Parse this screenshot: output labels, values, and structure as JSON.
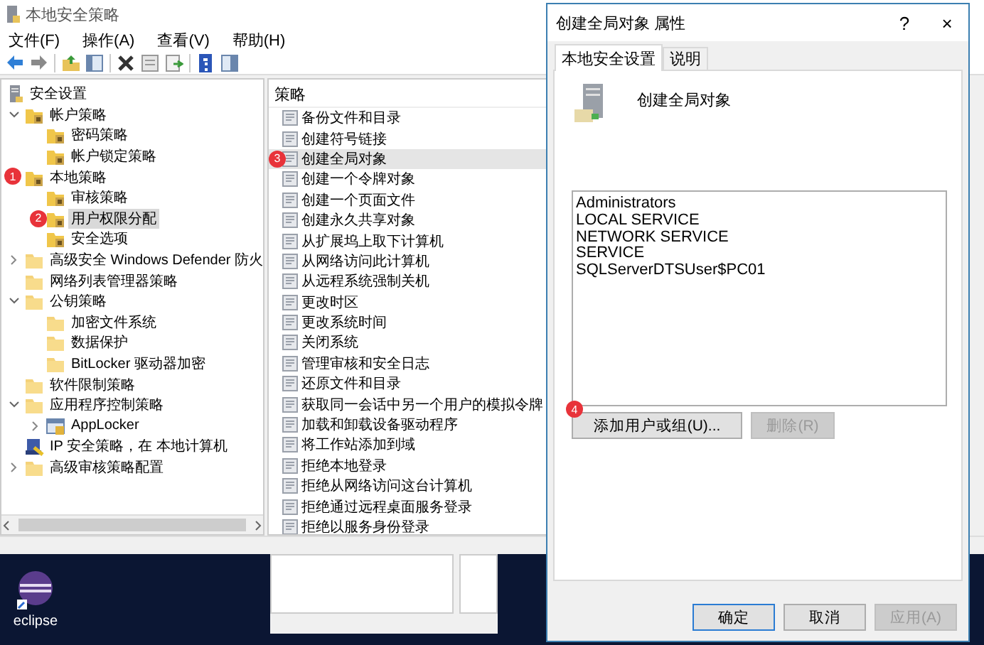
{
  "main_window": {
    "title": "本地安全策略",
    "menu": [
      "文件(F)",
      "操作(A)",
      "查看(V)",
      "帮助(H)"
    ],
    "tree": [
      {
        "label": "安全设置",
        "kind": "root",
        "selected": false,
        "children": [
          {
            "label": "帐户策略",
            "kind": "policy",
            "expanded": true,
            "selected": false,
            "children": [
              {
                "label": "密码策略",
                "kind": "policy",
                "selected": false
              },
              {
                "label": "帐户锁定策略",
                "kind": "policy",
                "selected": false
              }
            ]
          },
          {
            "label": "本地策略",
            "kind": "policy",
            "badge": "1",
            "selected": false,
            "children": [
              {
                "label": "审核策略",
                "kind": "policy",
                "selected": false
              },
              {
                "label": "用户权限分配",
                "kind": "policy",
                "badge": "2",
                "selected": true
              },
              {
                "label": "安全选项",
                "kind": "policy",
                "selected": false
              }
            ]
          },
          {
            "label": "高级安全 Windows Defender 防火",
            "kind": "folder",
            "expanded": false,
            "selected": false
          },
          {
            "label": "网络列表管理器策略",
            "kind": "folder",
            "selected": false
          },
          {
            "label": "公钥策略",
            "kind": "folder",
            "expanded": true,
            "selected": false,
            "children": [
              {
                "label": "加密文件系统",
                "kind": "folder",
                "selected": false
              },
              {
                "label": "数据保护",
                "kind": "folder",
                "selected": false
              },
              {
                "label": "BitLocker 驱动器加密",
                "kind": "folder",
                "selected": false
              }
            ]
          },
          {
            "label": "软件限制策略",
            "kind": "folder",
            "selected": false
          },
          {
            "label": "应用程序控制策略",
            "kind": "folder",
            "expanded": true,
            "selected": false,
            "children": [
              {
                "label": "AppLocker",
                "kind": "app",
                "expanded": false,
                "selected": false
              }
            ]
          },
          {
            "label": "IP 安全策略，在 本地计算机",
            "kind": "ip",
            "selected": false
          },
          {
            "label": "高级审核策略配置",
            "kind": "folder",
            "expanded": false,
            "selected": false
          }
        ]
      }
    ],
    "list_header": "策略",
    "policies": [
      {
        "label": "备份文件和目录",
        "selected": false
      },
      {
        "label": "创建符号链接",
        "selected": false
      },
      {
        "label": "创建全局对象",
        "selected": true,
        "badge": "3"
      },
      {
        "label": "创建一个令牌对象",
        "selected": false
      },
      {
        "label": "创建一个页面文件",
        "selected": false
      },
      {
        "label": "创建永久共享对象",
        "selected": false
      },
      {
        "label": "从扩展坞上取下计算机",
        "selected": false
      },
      {
        "label": "从网络访问此计算机",
        "selected": false
      },
      {
        "label": "从远程系统强制关机",
        "selected": false
      },
      {
        "label": "更改时区",
        "selected": false
      },
      {
        "label": "更改系统时间",
        "selected": false
      },
      {
        "label": "关闭系统",
        "selected": false
      },
      {
        "label": "管理审核和安全日志",
        "selected": false
      },
      {
        "label": "还原文件和目录",
        "selected": false
      },
      {
        "label": "获取同一会话中另一个用户的模拟令牌",
        "selected": false
      },
      {
        "label": "加载和卸载设备驱动程序",
        "selected": false
      },
      {
        "label": "将工作站添加到域",
        "selected": false
      },
      {
        "label": "拒绝本地登录",
        "selected": false
      },
      {
        "label": "拒绝从网络访问这台计算机",
        "selected": false
      },
      {
        "label": "拒绝通过远程桌面服务登录",
        "selected": false
      },
      {
        "label": "拒绝以服务身份登录",
        "selected": false
      }
    ]
  },
  "dialog": {
    "title": "创建全局对象 属性",
    "help": "?",
    "close": "×",
    "tabs": [
      {
        "label": "本地安全设置",
        "selected": true
      },
      {
        "label": "说明",
        "selected": false
      }
    ],
    "heading": "创建全局对象",
    "members": [
      "Administrators",
      "LOCAL SERVICE",
      "NETWORK SERVICE",
      "SERVICE",
      "SQLServerDTSUser$PC01"
    ],
    "actions": [
      {
        "label": "添加用户或组(U)...",
        "badge": "4",
        "disabled": false
      },
      {
        "label": "删除(R)",
        "disabled": true
      }
    ],
    "buttons": [
      {
        "label": "确定",
        "default": true,
        "disabled": false
      },
      {
        "label": "取消",
        "default": false,
        "disabled": false
      },
      {
        "label": "应用(A)",
        "default": false,
        "disabled": true
      }
    ]
  },
  "desktop": {
    "icons": [
      {
        "label": "eclipse"
      }
    ]
  }
}
